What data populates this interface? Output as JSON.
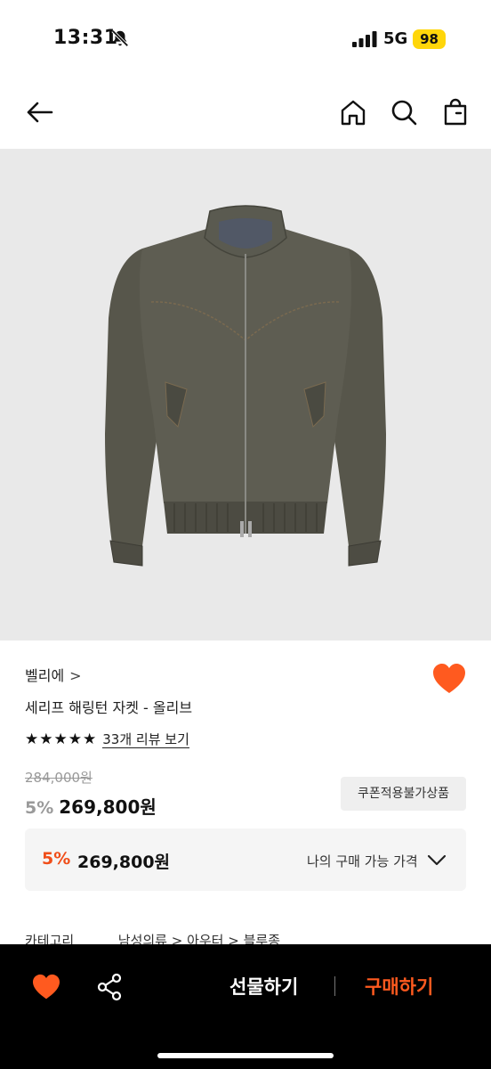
{
  "status_bar": {
    "time": "13:31",
    "network": "5G",
    "battery": "98"
  },
  "nav": {
    "icons": [
      "back-arrow-icon",
      "home-icon",
      "search-icon",
      "shopping-bag-icon"
    ]
  },
  "product": {
    "brand": "벨리에",
    "brand_chevron": ">",
    "name": "세리프 해링턴 자켓 - 올리브",
    "rating_stars": 5,
    "review_link": "33개 리뷰 보기",
    "original_price": "284,000원",
    "discount": "5%",
    "price": "269,800원",
    "coupon_badge": "쿠폰적용불가상품",
    "my_price": {
      "discount": "5%",
      "price": "269,800원",
      "label": "나의 구매 가능 가격"
    },
    "category": {
      "label": "카테고리",
      "path": "남성의류 > 아우터 > 블루종"
    }
  },
  "bottom_bar": {
    "gift_label": "선물하기",
    "buy_label": "구매하기"
  },
  "colors": {
    "accent": "#ff5a1f",
    "heart": "#ff5a1f",
    "discount_orange": "#f04e19"
  }
}
